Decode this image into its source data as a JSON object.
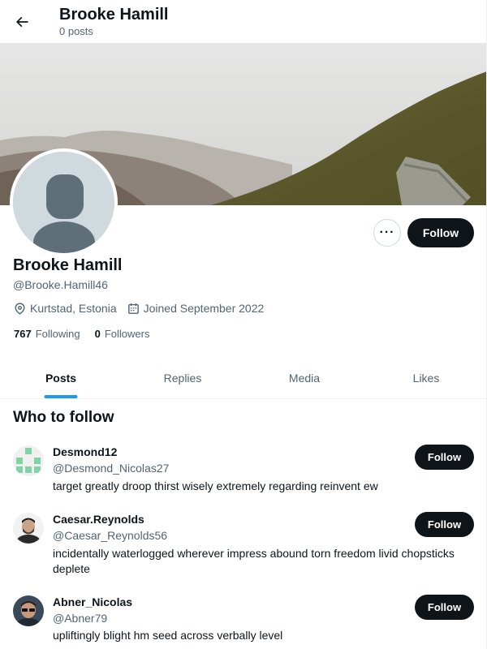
{
  "header": {
    "title": "Brooke Hamill",
    "post_count": "0 posts",
    "back_icon": "arrow-left-icon"
  },
  "profile": {
    "name": "Brooke Hamill",
    "handle": "@Brooke.Hamill46",
    "location": "Kurtstad, Estonia",
    "joined": "Joined September 2022",
    "following_count": "767",
    "following_label": "Following",
    "followers_count": "0",
    "followers_label": "Followers",
    "follow_label": "Follow",
    "more_label": "···"
  },
  "tabs": [
    {
      "label": "Posts",
      "active": true
    },
    {
      "label": "Replies",
      "active": false
    },
    {
      "label": "Media",
      "active": false
    },
    {
      "label": "Likes",
      "active": false
    }
  ],
  "who_to_follow": {
    "title": "Who to follow",
    "suggestions": [
      {
        "name": "Desmond12",
        "handle": "@Desmond_Nicolas27",
        "bio": "target greatly droop thirst wisely extremely regarding reinvent ew",
        "follow_label": "Follow"
      },
      {
        "name": "Caesar.Reynolds",
        "handle": "@Caesar_Reynolds56",
        "bio": "incidentally waterlogged wherever impress abound torn freedom livid chopsticks deplete",
        "follow_label": "Follow"
      },
      {
        "name": "Abner_Nicolas",
        "handle": "@Abner79",
        "bio": "upliftingly blight hm seed across verbally level",
        "follow_label": "Follow"
      }
    ]
  },
  "colors": {
    "accent": "#1d9bf0",
    "text_primary": "#0f1419",
    "text_secondary": "#536471",
    "button_dark": "#0f1419"
  }
}
